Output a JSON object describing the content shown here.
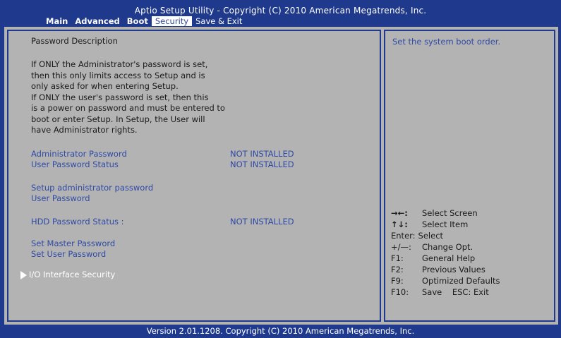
{
  "header": {
    "title": "Aptio Setup Utility - Copyright (C) 2010 American Megatrends, Inc."
  },
  "tabs": [
    "Main",
    "Advanced",
    "Boot",
    "Security",
    "Save & Exit"
  ],
  "left": {
    "heading": "Password Description",
    "description": [
      "If ONLY the Administrator's password is set,",
      "then this only limits access to Setup and is",
      "only asked for when entering Setup.",
      "If ONLY the user's password is set, then this",
      "is a power on password and must be entered to",
      "boot or enter Setup. In Setup, the User will",
      "have Administrator rights."
    ],
    "admin_password_label": "Administrator Password",
    "admin_password_value": "NOT INSTALLED",
    "user_password_status_label": "User Password Status",
    "user_password_status_value": "NOT INSTALLED",
    "setup_admin_password": "Setup administrator password",
    "user_password": "User Password",
    "hdd_password_status_label": "HDD Password Status :",
    "hdd_password_status_value": "NOT INSTALLED",
    "set_master_password": "Set Master Password",
    "set_user_password": "Set User Password",
    "io_interface_security": "I/O Interface Security"
  },
  "right": {
    "help_text": "Set the system boot order.",
    "keys": [
      {
        "key": "→←:",
        "desc": "Select Screen"
      },
      {
        "key": "↑↓:",
        "desc": "Select Item"
      },
      {
        "key": "Enter:",
        "desc": "Select"
      },
      {
        "key": "+/—:",
        "desc": "Change Opt."
      },
      {
        "key": "F1:",
        "desc": "General Help"
      },
      {
        "key": "F2:",
        "desc": "Previous Values"
      },
      {
        "key": "F9:",
        "desc": "Optimized Defaults"
      },
      {
        "key": "F10:",
        "desc": "Save    ESC: Exit"
      }
    ]
  },
  "footer": {
    "text": "Version 2.01.1208. Copyright (C) 2010 American Megatrends, Inc."
  }
}
